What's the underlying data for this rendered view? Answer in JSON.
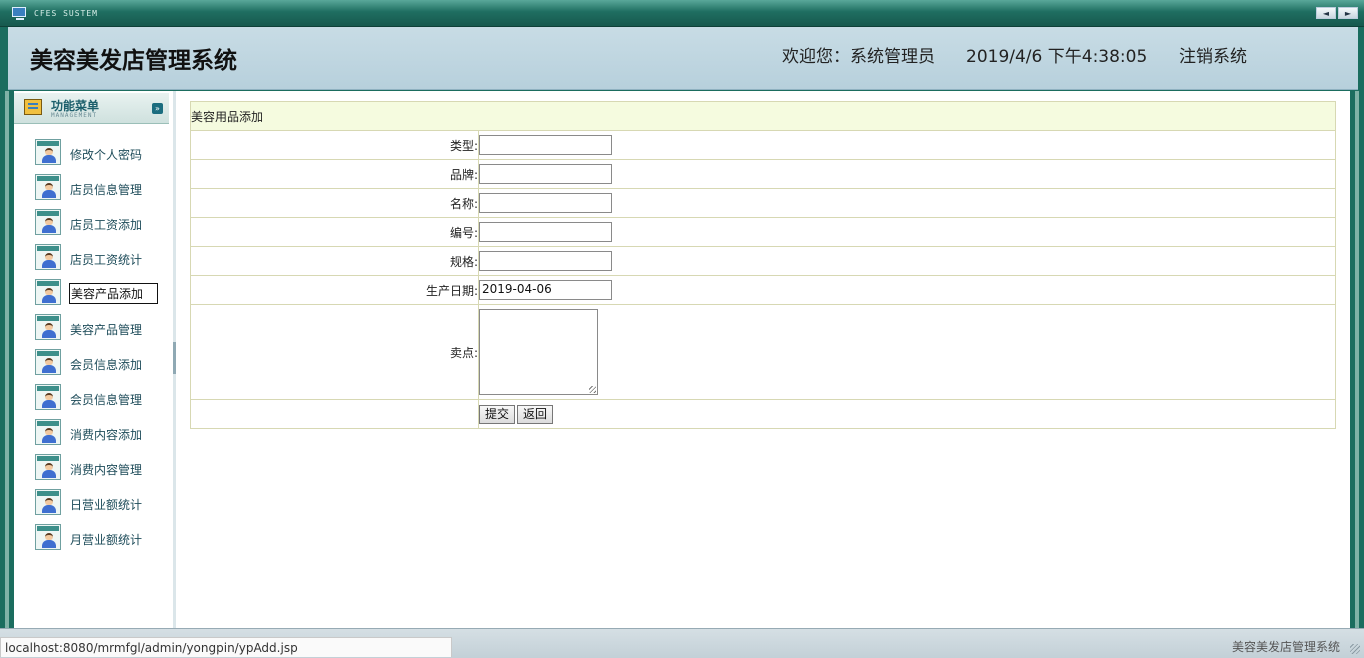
{
  "topbar": {
    "system_name": "CFES SUSTEM",
    "nav_prev": "◄",
    "nav_next": "►"
  },
  "header": {
    "app_title": "美容美发店管理系统",
    "welcome": "欢迎您：系统管理员",
    "datetime": "2019/4/6 下午4:38:05",
    "logout": "注销系统"
  },
  "sidebar": {
    "menu_title": "功能菜单",
    "menu_subtitle": "MANAGEMENT",
    "toggle": "»",
    "items": [
      {
        "label": "修改个人密码"
      },
      {
        "label": "店员信息管理"
      },
      {
        "label": "店员工资添加"
      },
      {
        "label": "店员工资统计"
      },
      {
        "label": "美容产品添加",
        "active": true
      },
      {
        "label": "美容产品管理"
      },
      {
        "label": "会员信息添加"
      },
      {
        "label": "会员信息管理"
      },
      {
        "label": "消费内容添加"
      },
      {
        "label": "消费内容管理"
      },
      {
        "label": "日营业额统计"
      },
      {
        "label": "月营业额统计"
      }
    ]
  },
  "form": {
    "caption": "美容用品添加",
    "fields": [
      {
        "label": "类型:",
        "value": ""
      },
      {
        "label": "品牌:",
        "value": ""
      },
      {
        "label": "名称:",
        "value": ""
      },
      {
        "label": "编号:",
        "value": ""
      },
      {
        "label": "规格:",
        "value": ""
      },
      {
        "label": "生产日期:",
        "value": "2019-04-06"
      }
    ],
    "selling_point_label": "卖点:",
    "selling_point_value": "",
    "submit": "提交",
    "back": "返回"
  },
  "footer": {
    "text": "美容美发店管理系统"
  },
  "statusbar": {
    "url": "localhost:8080/mrmfgl/admin/yongpin/ypAdd.jsp"
  },
  "colors": {
    "frame": "#1b6d5f",
    "header_bg": "#bcd3de",
    "caption_bg": "#f5fbdf",
    "table_border": "#d7d8b3"
  }
}
